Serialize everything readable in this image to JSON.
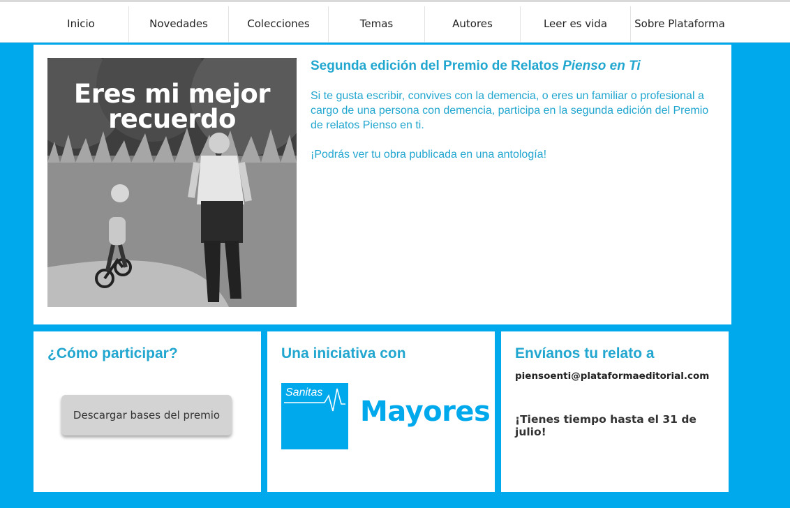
{
  "nav": {
    "items": [
      {
        "label": "Inicio"
      },
      {
        "label": "Novedades"
      },
      {
        "label": "Colecciones"
      },
      {
        "label": "Temas"
      },
      {
        "label": "Autores"
      },
      {
        "label": "Leer es vida"
      },
      {
        "label": "Sobre Plataforma"
      }
    ]
  },
  "hero": {
    "image_caption": "Eres mi mejor recuerdo",
    "image_caption_line1": "Eres mi mejor",
    "image_caption_line2": "recuerdo",
    "title_prefix": "Segunda edición del Premio de Relatos",
    "title_emphasis": "Pienso en Ti",
    "body_paragraph_1": "Si te gusta escribir, convives con la demencia, o eres un familiar o profesional a cargo de una persona con demencia, participa en la segunda edición del Premio de relatos Pienso en ti.",
    "body_paragraph_2": "¡Podrás ver tu obra publicada en una antología!"
  },
  "participate": {
    "title": "¿Cómo participar?",
    "download_button_label": "Descargar bases del premio"
  },
  "initiative": {
    "title": "Una iniciativa con",
    "logo_sanitas": "Sanitas",
    "logo_mayores": "Mayores"
  },
  "submit": {
    "title": "Envíanos tu relato a",
    "email": "piensoenti@plataformaeditorial.com",
    "deadline": "¡Tienes tiempo hasta el 31 de julio!"
  },
  "colors": {
    "page_background": "#00a8ec",
    "accent_text": "#21a6cf",
    "button_background": "#d3d3d3"
  }
}
